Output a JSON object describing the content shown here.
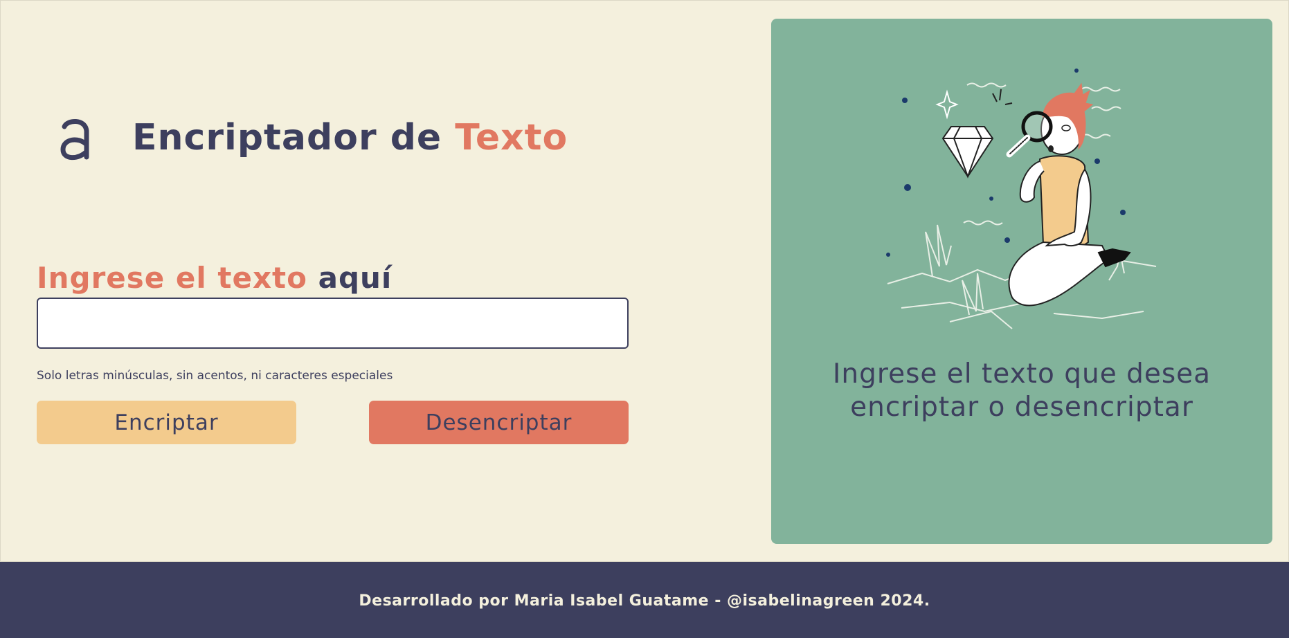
{
  "header": {
    "logo_icon": "alura-a-logo-icon",
    "title_main": "Encriptador de ",
    "title_accent": "Texto"
  },
  "form": {
    "label_part1": "Ingrese el texto ",
    "label_part2": "aquí",
    "input_value": "",
    "hint": "Solo letras minúsculas, sin acentos, ni caracteres especiales",
    "encrypt_label": "Encriptar",
    "decrypt_label": "Desencriptar"
  },
  "panel": {
    "illustration_icon": "person-with-magnifying-glass-illustration",
    "message_line1": "Ingrese el texto que desea",
    "message_line2": "encriptar o desencriptar"
  },
  "footer": {
    "text": "Desarrollado por Maria Isabel Guatame - @isabelinagreen 2024."
  },
  "colors": {
    "background": "#f4f0dd",
    "dark": "#3d3f5e",
    "accent": "#e17861",
    "encrypt_button": "#f3cb8d",
    "panel": "#82b39b"
  }
}
